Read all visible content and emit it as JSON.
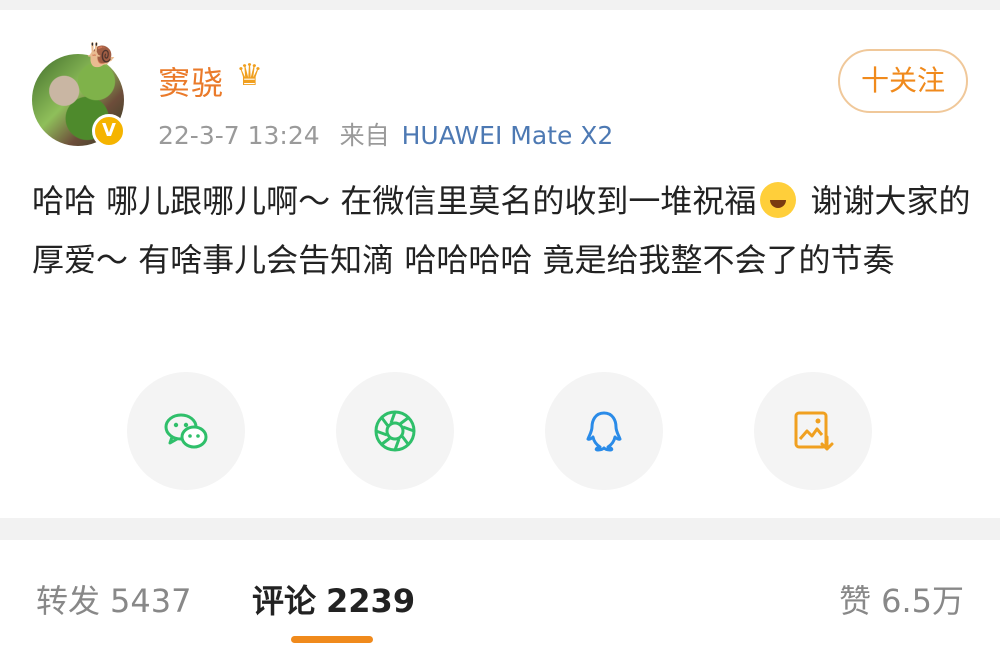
{
  "post": {
    "username": "窦骁",
    "timestamp": "22-3-7 13:24",
    "from_label": "来自",
    "device": "HUAWEI Mate X2",
    "follow_label": "十关注",
    "content": {
      "part1": "哈哈 哪儿跟哪儿啊～ 在微信里莫名的收到一堆祝福",
      "part2": " 谢谢大家的厚爱～ 有啥事儿会告知滴 哈哈哈哈 竟是给我整不会了的节奏"
    }
  },
  "share": [
    {
      "icon": "wechat-icon",
      "color": "#2fbf6a"
    },
    {
      "icon": "moments-icon",
      "color": "#2fbf6a"
    },
    {
      "icon": "qq-icon",
      "color": "#2a8be8"
    },
    {
      "icon": "save-image-icon",
      "color": "#f0a020"
    }
  ],
  "tabs": {
    "repost": {
      "label": "转发",
      "count": "5437"
    },
    "comment": {
      "label": "评论",
      "count": "2239"
    },
    "like": {
      "label": "赞",
      "count": "6.5万"
    }
  },
  "colors": {
    "accent": "#f08a1c",
    "username": "#ea7a2a",
    "device_link": "#4d79b3"
  }
}
